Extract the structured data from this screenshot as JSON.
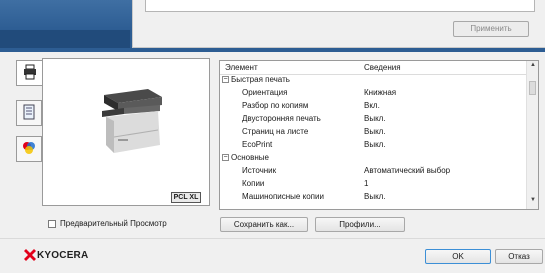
{
  "top": {
    "apply_label": "Применить"
  },
  "side_tabs": [
    {
      "icon": "printer-icon"
    },
    {
      "icon": "document-icon"
    },
    {
      "icon": "color-icon"
    }
  ],
  "preview": {
    "badge": "PCL XL"
  },
  "tree": {
    "headers": {
      "element": "Элемент",
      "details": "Сведения"
    },
    "rows": [
      {
        "type": "group",
        "label": "Быстрая печать",
        "value": ""
      },
      {
        "type": "item",
        "label": "Ориентация",
        "value": "Книжная"
      },
      {
        "type": "item",
        "label": "Разбор по копиям",
        "value": "Вкл."
      },
      {
        "type": "item",
        "label": "Двусторонняя печать",
        "value": "Выкл."
      },
      {
        "type": "item",
        "label": "Страниц на листе",
        "value": "Выкл."
      },
      {
        "type": "item",
        "label": "EcoPrint",
        "value": "Выкл."
      },
      {
        "type": "group",
        "label": "Основные",
        "value": ""
      },
      {
        "type": "item",
        "label": "Источник",
        "value": "Автоматический выбор"
      },
      {
        "type": "item",
        "label": "Копии",
        "value": "1"
      },
      {
        "type": "item",
        "label": "Машинописные копии",
        "value": "Выкл."
      }
    ]
  },
  "preview_checkbox": {
    "label": "Предварительный Просмотр",
    "checked": false
  },
  "buttons": {
    "save_as": "Сохранить как...",
    "profiles": "Профили...",
    "ok": "OK",
    "cancel": "Отказ"
  },
  "brand": {
    "name": "KYOCERA",
    "accent": "#e2001a"
  }
}
